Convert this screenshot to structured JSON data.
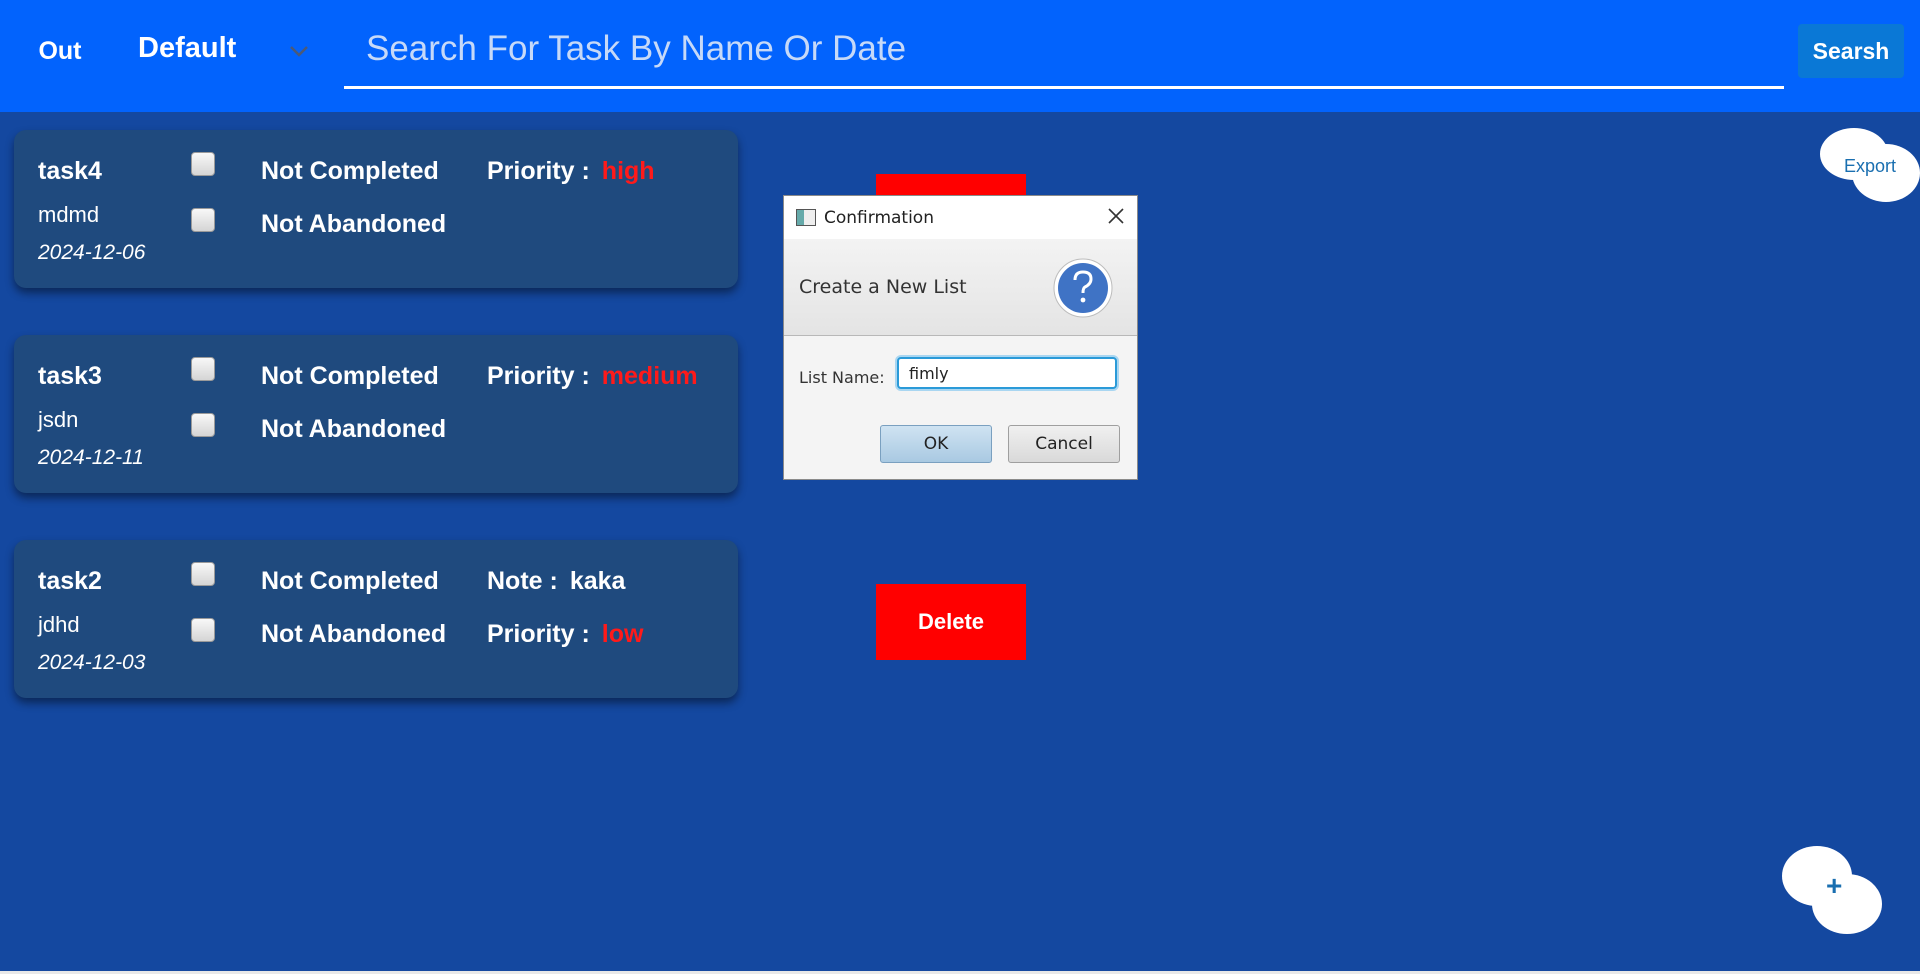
{
  "topbar": {
    "out_label": "Out",
    "list_selected": "Default",
    "search_placeholder": "Search For Task By Name Or Date",
    "search_value": "",
    "search_label": "Searsh"
  },
  "tasks": [
    {
      "name": "task4",
      "description": "mdmd",
      "date": "2024-12-06",
      "completed_status": "Not Completed",
      "abandoned_status": "Not Abandoned",
      "completed_checked": false,
      "abandoned_checked": false,
      "field1_label": "Priority :",
      "field1_value": "high"
    },
    {
      "name": "task3",
      "description": "jsdn",
      "date": "2024-12-11",
      "completed_status": "Not Completed",
      "abandoned_status": "Not Abandoned",
      "completed_checked": false,
      "abandoned_checked": false,
      "field1_label": "Priority :",
      "field1_value": "medium"
    },
    {
      "name": "task2",
      "description": "jdhd",
      "date": "2024-12-03",
      "completed_status": "Not Completed",
      "abandoned_status": "Not Abandoned",
      "completed_checked": false,
      "abandoned_checked": false,
      "field1_label": "Note :",
      "field1_value": "kaka",
      "field2_label": "Priority :",
      "field2_value": "low"
    }
  ],
  "delete_buttons": [
    {
      "label": ""
    },
    {
      "label": "Delete"
    }
  ],
  "export_label": "Export",
  "add_label": "+",
  "dialog": {
    "title": "Confirmation",
    "header_text": "Create a New List",
    "field_label": "List Name:",
    "field_value": "fimly",
    "ok_label": "OK",
    "cancel_label": "Cancel",
    "icon": "question-icon"
  },
  "colors": {
    "topbar": "#0263fd",
    "background": "#1448a0",
    "card": "#1f4a7e",
    "priority": "#ff1a1a",
    "delete": "#ff0000"
  }
}
